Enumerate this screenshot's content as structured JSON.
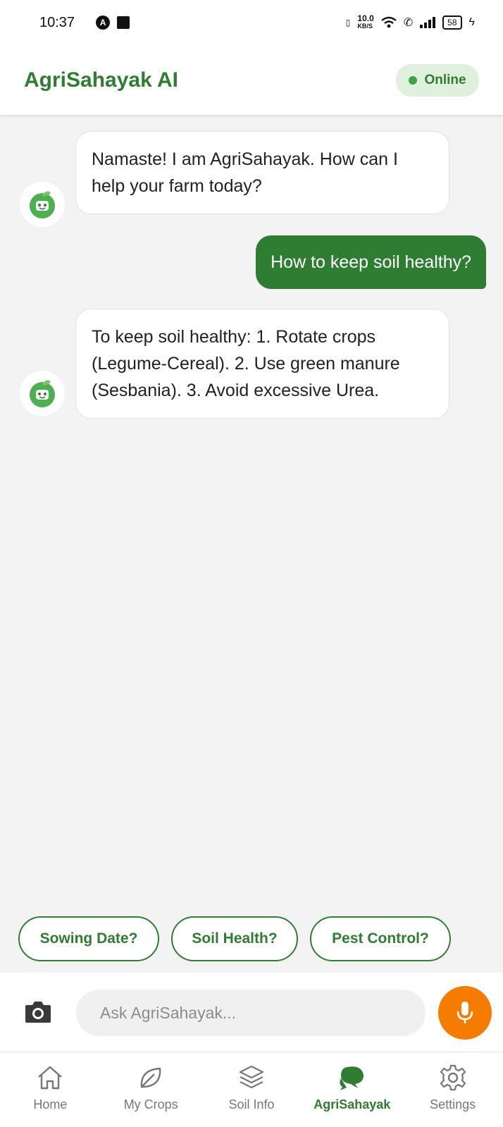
{
  "status_bar": {
    "time": "10:37",
    "net_speed_value": "10.0",
    "net_speed_unit": "KB/S",
    "battery": "58"
  },
  "header": {
    "title": "AgriSahayak AI",
    "status": "Online"
  },
  "messages": [
    {
      "sender": "bot",
      "text": "Namaste! I am AgriSahayak. How can I help your farm today?"
    },
    {
      "sender": "user",
      "text": "How to keep soil healthy?"
    },
    {
      "sender": "bot",
      "text": "To keep soil healthy: 1. Rotate crops (Legume-Cereal). 2. Use green manure (Sesbania). 3. Avoid excessive Urea."
    }
  ],
  "quick_replies": [
    "Sowing Date?",
    "Soil Health?",
    "Pest Control?"
  ],
  "input": {
    "placeholder": "Ask AgriSahayak...",
    "value": ""
  },
  "nav": {
    "items": [
      {
        "label": "Home",
        "icon": "home-icon"
      },
      {
        "label": "My Crops",
        "icon": "leaf-icon"
      },
      {
        "label": "Soil Info",
        "icon": "layers-icon"
      },
      {
        "label": "AgriSahayak",
        "icon": "chat-bubbles-icon",
        "active": true
      },
      {
        "label": "Settings",
        "icon": "gear-icon"
      }
    ]
  },
  "colors": {
    "primary": "#2e7d32",
    "accent": "#f57c00",
    "online_pill_bg": "#dff0dc",
    "background": "#f3f3f3"
  }
}
